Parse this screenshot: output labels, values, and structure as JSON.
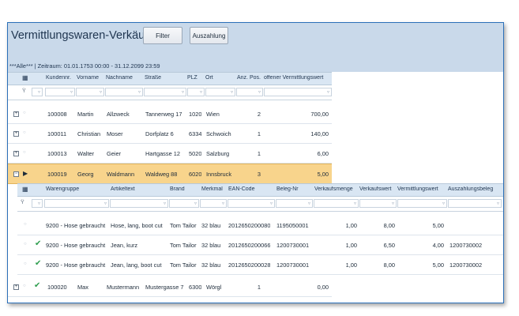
{
  "title": "Vermittlungswaren-Verkäufe",
  "buttons": {
    "filter": "Filter",
    "auszahlung": "Auszahlung"
  },
  "zeitraum": "***Alle*** | Zeitraum: 01.01.1753 00:00 - 31.12.2099 23:59",
  "customer_columns": [
    "Kundennr.",
    "Vorname",
    "Nachname",
    "Straße",
    "PLZ",
    "Ort",
    "Anz. Pos.",
    "offener Vermittlungswert"
  ],
  "customers": [
    {
      "nr": "100008",
      "vorname": "Martin",
      "nachname": "Allzweck",
      "strasse": "Tannerweg 17",
      "plz": "1020",
      "ort": "Wien",
      "anz": "2",
      "wert": "700,00"
    },
    {
      "nr": "100011",
      "vorname": "Christian",
      "nachname": "Moser",
      "strasse": "Dorfplatz 6",
      "plz": "6334",
      "ort": "Schwoich",
      "anz": "1",
      "wert": "140,00"
    },
    {
      "nr": "100013",
      "vorname": "Walter",
      "nachname": "Geier",
      "strasse": "Hartgasse 12",
      "plz": "5020",
      "ort": "Salzburg",
      "anz": "1",
      "wert": "6,00"
    },
    {
      "nr": "100019",
      "vorname": "Georg",
      "nachname": "Waldmann",
      "strasse": "Waldweg 88",
      "plz": "6020",
      "ort": "Innsbruck",
      "anz": "3",
      "wert": "5,00"
    }
  ],
  "last_customer": {
    "nr": "100020",
    "vorname": "Max",
    "nachname": "Mustermann",
    "strasse": "Mustergasse 7",
    "plz": "6300",
    "ort": "Wörgl",
    "anz": "1",
    "wert": "0,00"
  },
  "detail_columns": [
    "Warengruppe",
    "Artikeltext",
    "Brand",
    "Merkmal",
    "EAN-Code",
    "Beleg-Nr",
    "Verkaufsmenge",
    "Verkaufswert",
    "Vermittlungswert",
    "Auszahlungsbeleg"
  ],
  "details": [
    {
      "gruppe": "9200 - Hose gebraucht",
      "artikel": "Hose, lang, boot cut",
      "brand": "Tom Tailor",
      "merkmal": "32 blau",
      "ean": "2012650200080",
      "beleg": "1195050001",
      "menge": "1,00",
      "vkwert": "8,00",
      "vmwert": "5,00",
      "azbeleg": ""
    },
    {
      "gruppe": "9200 - Hose gebraucht",
      "artikel": "Jean, kurz",
      "brand": "Tom Tailor",
      "merkmal": "32 blau",
      "ean": "2012650200066",
      "beleg": "1200730001",
      "menge": "1,00",
      "vkwert": "6,50",
      "vmwert": "4,00",
      "azbeleg": "1200730002"
    },
    {
      "gruppe": "9200 - Hose gebraucht",
      "artikel": "Jean, lang, boot cut",
      "brand": "Tom Tailor",
      "merkmal": "32 blau",
      "ean": "2012650200028",
      "beleg": "1200730001",
      "menge": "1,00",
      "vkwert": "8,00",
      "vmwert": "5,00",
      "azbeleg": "1200730002"
    }
  ],
  "icons": {
    "expand": "plus-box-icon",
    "collapse": "minus-box-icon",
    "check": "checkmark-icon",
    "filter": "funnel-icon",
    "column_chooser": "column-chooser-icon"
  },
  "colors": {
    "header_bg": "#c9d9ea",
    "selected_row": "#f8d48c",
    "check": "#2f9e4f",
    "border": "#2a6fb8"
  }
}
